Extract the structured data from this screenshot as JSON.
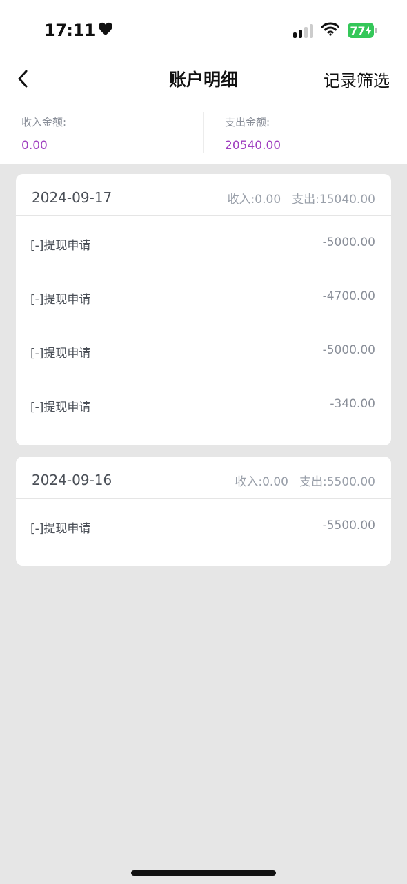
{
  "status_bar": {
    "time": "17:11",
    "battery": "77",
    "colors": {
      "battery": "#34c759"
    }
  },
  "nav": {
    "title": "账户明细",
    "filter_label": "记录筛选",
    "back_icon": "chevron-left-icon"
  },
  "summary": {
    "income_label": "收入金额:",
    "income_value": "0.00",
    "expense_label": "支出金额:",
    "expense_value": "20540.00",
    "accent_color": "#a040c0"
  },
  "groups": [
    {
      "date": "2024-09-17",
      "income": "收入:0.00",
      "expense": "支出:15040.00",
      "items": [
        {
          "label": "[-]提现申请",
          "amount": "-5000.00"
        },
        {
          "label": "[-]提现申请",
          "amount": "-4700.00"
        },
        {
          "label": "[-]提现申请",
          "amount": "-5000.00"
        },
        {
          "label": "[-]提现申请",
          "amount": "-340.00"
        }
      ]
    },
    {
      "date": "2024-09-16",
      "income": "收入:0.00",
      "expense": "支出:5500.00",
      "items": [
        {
          "label": "[-]提现申请",
          "amount": "-5500.00"
        }
      ]
    }
  ]
}
